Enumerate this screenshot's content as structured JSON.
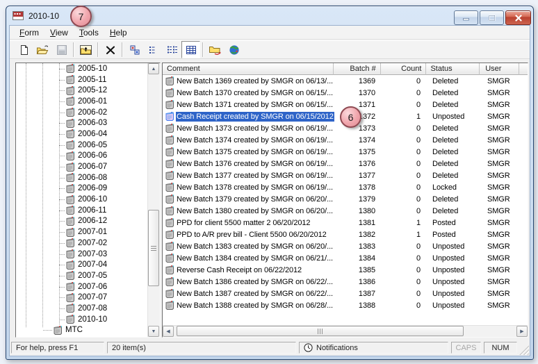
{
  "window": {
    "title": "2010-10",
    "controls": {
      "minimize": "minimize",
      "maximize": "maximize",
      "close": "close"
    }
  },
  "menu": {
    "items": [
      {
        "label": "Form"
      },
      {
        "label": "View"
      },
      {
        "label": "Tools"
      },
      {
        "label": "Help"
      }
    ]
  },
  "toolbar": {
    "buttons": [
      {
        "name": "new-document",
        "icon": "new-document-icon",
        "state": "normal",
        "group": 1
      },
      {
        "name": "open",
        "icon": "open-folder-icon",
        "state": "normal",
        "group": 1
      },
      {
        "name": "save",
        "icon": "save-icon",
        "state": "disabled",
        "group": 1
      },
      {
        "name": "up-one-level",
        "icon": "up-folder-icon",
        "state": "normal",
        "group": 2
      },
      {
        "name": "delete",
        "icon": "delete-x-icon",
        "state": "normal",
        "group": 3
      },
      {
        "name": "small-icons-view",
        "icon": "small-icons-view-icon",
        "state": "normal",
        "group": 4
      },
      {
        "name": "list-view",
        "icon": "list-view-icon",
        "state": "normal",
        "group": 4
      },
      {
        "name": "multi-list-view",
        "icon": "multi-list-view-icon",
        "state": "normal",
        "group": 4
      },
      {
        "name": "details-view",
        "icon": "details-view-icon",
        "state": "pressed",
        "group": 4
      },
      {
        "name": "post-folder",
        "icon": "folder-arrow-icon",
        "state": "normal",
        "group": 5
      },
      {
        "name": "internet",
        "icon": "globe-icon",
        "state": "normal",
        "group": 5
      }
    ]
  },
  "tree": {
    "items": [
      {
        "label": "2005-10",
        "level": 4
      },
      {
        "label": "2005-11",
        "level": 4
      },
      {
        "label": "2005-12",
        "level": 4
      },
      {
        "label": "2006-01",
        "level": 4
      },
      {
        "label": "2006-02",
        "level": 4
      },
      {
        "label": "2006-03",
        "level": 4
      },
      {
        "label": "2006-04",
        "level": 4
      },
      {
        "label": "2006-05",
        "level": 4
      },
      {
        "label": "2006-06",
        "level": 4
      },
      {
        "label": "2006-07",
        "level": 4
      },
      {
        "label": "2006-08",
        "level": 4
      },
      {
        "label": "2006-09",
        "level": 4
      },
      {
        "label": "2006-10",
        "level": 4
      },
      {
        "label": "2006-11",
        "level": 4
      },
      {
        "label": "2006-12",
        "level": 4
      },
      {
        "label": "2007-01",
        "level": 4
      },
      {
        "label": "2007-02",
        "level": 4
      },
      {
        "label": "2007-03",
        "level": 4
      },
      {
        "label": "2007-04",
        "level": 4
      },
      {
        "label": "2007-05",
        "level": 4
      },
      {
        "label": "2007-06",
        "level": 4
      },
      {
        "label": "2007-07",
        "level": 4
      },
      {
        "label": "2007-08",
        "level": 4
      },
      {
        "label": "2010-10",
        "level": 4
      },
      {
        "label": "MTC",
        "level": 3
      }
    ]
  },
  "list": {
    "columns": [
      {
        "id": "comment",
        "label": "Comment",
        "align": "left"
      },
      {
        "id": "batch",
        "label": "Batch #",
        "align": "right"
      },
      {
        "id": "count",
        "label": "Count",
        "align": "right"
      },
      {
        "id": "status",
        "label": "Status",
        "align": "left"
      },
      {
        "id": "user",
        "label": "User",
        "align": "left"
      }
    ],
    "rows": [
      {
        "comment": "New Batch 1369 created by SMGR on 06/13/...",
        "batch": "1369",
        "count": "0",
        "status": "Deleted",
        "user": "SMGR",
        "selected": false
      },
      {
        "comment": "New Batch 1370 created by SMGR on 06/15/...",
        "batch": "1370",
        "count": "0",
        "status": "Deleted",
        "user": "SMGR",
        "selected": false
      },
      {
        "comment": "New Batch 1371 created by SMGR on 06/15/...",
        "batch": "1371",
        "count": "0",
        "status": "Deleted",
        "user": "SMGR",
        "selected": false
      },
      {
        "comment": "Cash Receipt created by SMGR on 06/15/2012",
        "batch": "1372",
        "count": "1",
        "status": "Unposted",
        "user": "SMGR",
        "selected": true
      },
      {
        "comment": "New Batch 1373 created by SMGR on 06/19/...",
        "batch": "1373",
        "count": "0",
        "status": "Deleted",
        "user": "SMGR",
        "selected": false
      },
      {
        "comment": "New Batch 1374 created by SMGR on 06/19/...",
        "batch": "1374",
        "count": "0",
        "status": "Deleted",
        "user": "SMGR",
        "selected": false
      },
      {
        "comment": "New Batch 1375 created by SMGR on 06/19/...",
        "batch": "1375",
        "count": "0",
        "status": "Deleted",
        "user": "SMGR",
        "selected": false
      },
      {
        "comment": "New Batch 1376 created by SMGR on 06/19/...",
        "batch": "1376",
        "count": "0",
        "status": "Deleted",
        "user": "SMGR",
        "selected": false
      },
      {
        "comment": "New Batch 1377 created by SMGR on 06/19/...",
        "batch": "1377",
        "count": "0",
        "status": "Deleted",
        "user": "SMGR",
        "selected": false
      },
      {
        "comment": "New Batch 1378 created by SMGR on 06/19/...",
        "batch": "1378",
        "count": "0",
        "status": "Locked",
        "user": "SMGR",
        "selected": false
      },
      {
        "comment": "New Batch 1379 created by SMGR on 06/20/...",
        "batch": "1379",
        "count": "0",
        "status": "Deleted",
        "user": "SMGR",
        "selected": false
      },
      {
        "comment": "New Batch 1380 created by SMGR on 06/20/...",
        "batch": "1380",
        "count": "0",
        "status": "Deleted",
        "user": "SMGR",
        "selected": false
      },
      {
        "comment": "PPD for client 5500 matter 2  06/20/2012",
        "batch": "1381",
        "count": "1",
        "status": "Posted",
        "user": "SMGR",
        "selected": false
      },
      {
        "comment": "PPD to A/R prev bill - Client 5500 06/20/2012",
        "batch": "1382",
        "count": "1",
        "status": "Posted",
        "user": "SMGR",
        "selected": false
      },
      {
        "comment": "New Batch 1383 created by SMGR on 06/20/...",
        "batch": "1383",
        "count": "0",
        "status": "Unposted",
        "user": "SMGR",
        "selected": false
      },
      {
        "comment": "New Batch 1384 created by SMGR on 06/21/...",
        "batch": "1384",
        "count": "0",
        "status": "Unposted",
        "user": "SMGR",
        "selected": false
      },
      {
        "comment": "Reverse Cash Receipt on 06/22/2012",
        "batch": "1385",
        "count": "0",
        "status": "Unposted",
        "user": "SMGR",
        "selected": false
      },
      {
        "comment": "New Batch 1386 created by SMGR on 06/22/...",
        "batch": "1386",
        "count": "0",
        "status": "Unposted",
        "user": "SMGR",
        "selected": false
      },
      {
        "comment": "New Batch 1387 created by SMGR on 06/22/...",
        "batch": "1387",
        "count": "0",
        "status": "Unposted",
        "user": "SMGR",
        "selected": false
      },
      {
        "comment": "New Batch 1388 created by SMGR on 06/28/...",
        "batch": "1388",
        "count": "0",
        "status": "Unposted",
        "user": "SMGR",
        "selected": false
      }
    ]
  },
  "statusbar": {
    "help_text": "For help, press F1",
    "item_count": "20 item(s)",
    "notifications_label": "Notifications",
    "caps_indicator": "CAPS",
    "num_indicator": "NUM"
  },
  "callouts": [
    {
      "label": "7"
    },
    {
      "label": "6"
    }
  ],
  "colors": {
    "selection": "#2E64C8",
    "callout_fill_light": "#FCDADD",
    "callout_fill_mid": "#F0A5AC",
    "callout_fill_dark": "#E08B94",
    "callout_border": "#8E4A52",
    "titlebar_top": "#E8F1FB",
    "titlebar_bottom": "#BDD2EC"
  }
}
